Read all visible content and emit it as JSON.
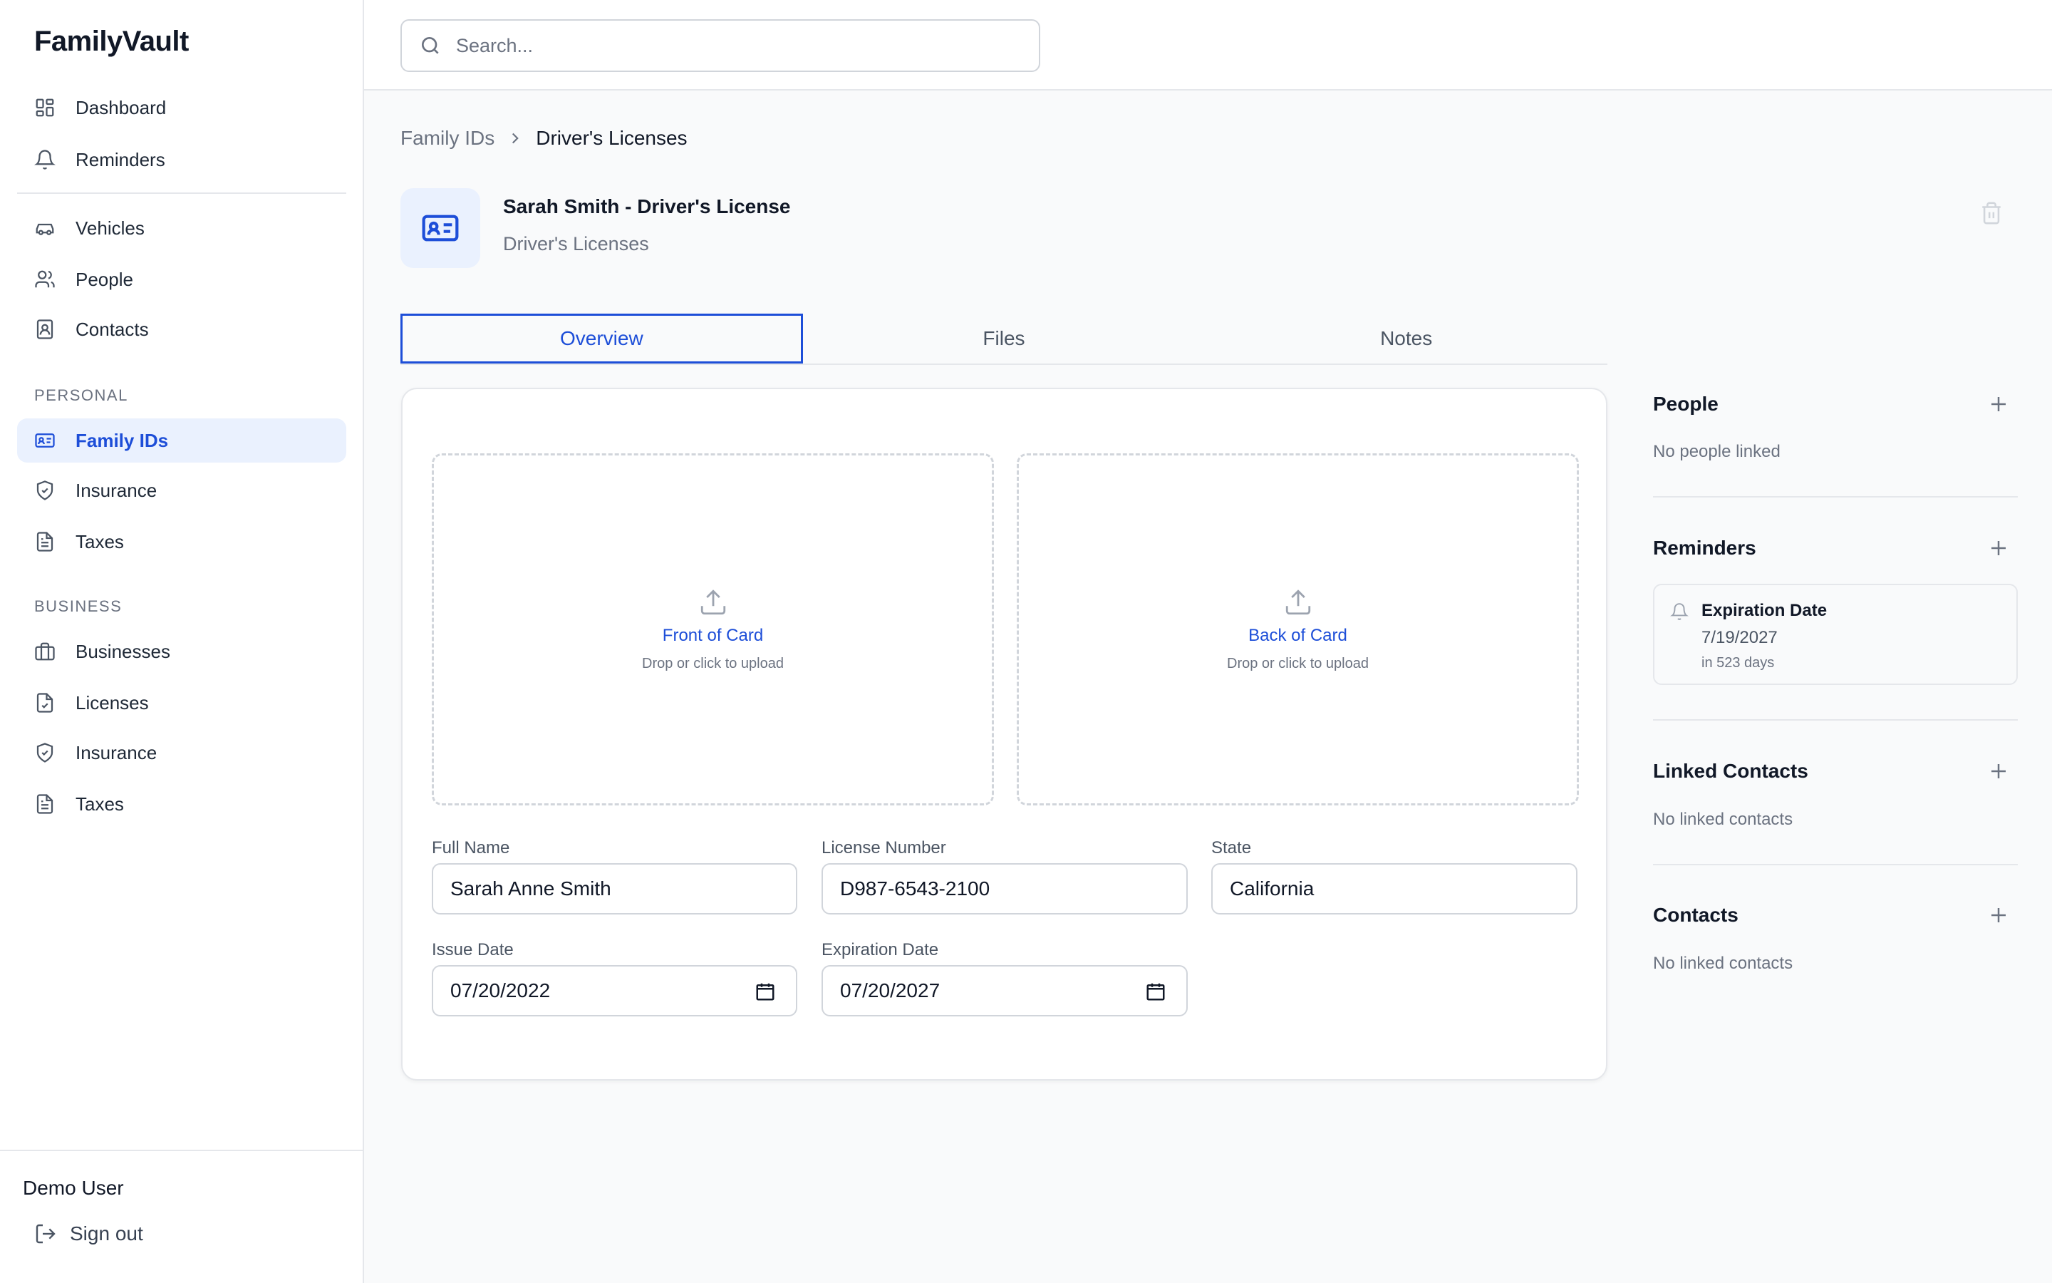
{
  "app": {
    "brand": "FamilyVault"
  },
  "sidebar": {
    "main_items": [
      {
        "label": "Dashboard",
        "icon": "dashboard-icon"
      },
      {
        "label": "Reminders",
        "icon": "bell-icon"
      },
      {
        "label": "Vehicles",
        "icon": "car-icon"
      },
      {
        "label": "People",
        "icon": "users-icon"
      },
      {
        "label": "Contacts",
        "icon": "contact-book-icon"
      }
    ],
    "personal": {
      "heading": "PERSONAL",
      "items": [
        {
          "label": "Family IDs",
          "icon": "id-card-icon",
          "active": true
        },
        {
          "label": "Insurance",
          "icon": "shield-icon"
        },
        {
          "label": "Taxes",
          "icon": "document-icon"
        }
      ]
    },
    "business": {
      "heading": "BUSINESS",
      "items": [
        {
          "label": "Businesses",
          "icon": "briefcase-icon"
        },
        {
          "label": "Licenses",
          "icon": "file-check-icon"
        },
        {
          "label": "Insurance",
          "icon": "shield-icon"
        },
        {
          "label": "Taxes",
          "icon": "document-icon"
        }
      ]
    },
    "footer": {
      "user_name": "Demo User",
      "signout_label": "Sign out"
    }
  },
  "search": {
    "placeholder": "Search...",
    "value": ""
  },
  "breadcrumb": {
    "parent": "Family IDs",
    "current": "Driver's Licenses"
  },
  "document": {
    "title": "Sarah Smith - Driver's License",
    "subtitle": "Driver's Licenses"
  },
  "tabs": [
    {
      "label": "Overview",
      "active": true
    },
    {
      "label": "Files",
      "active": false
    },
    {
      "label": "Notes",
      "active": false
    }
  ],
  "uploads": {
    "front": {
      "title": "Front of Card",
      "hint": "Drop or click to upload"
    },
    "back": {
      "title": "Back of Card",
      "hint": "Drop or click to upload"
    }
  },
  "fields": {
    "full_name": {
      "label": "Full Name",
      "value": "Sarah Anne Smith"
    },
    "license_number": {
      "label": "License Number",
      "value": "D987-6543-2100"
    },
    "state": {
      "label": "State",
      "value": "California"
    },
    "issue_date": {
      "label": "Issue Date",
      "value": "07/20/2022"
    },
    "expiration_date": {
      "label": "Expiration Date",
      "value": "07/20/2027"
    }
  },
  "right_panel": {
    "people": {
      "title": "People",
      "empty": "No people linked"
    },
    "reminders": {
      "title": "Reminders",
      "items": [
        {
          "title": "Expiration Date",
          "date": "7/19/2027",
          "relative": "in 523 days"
        }
      ]
    },
    "linked_contacts": {
      "title": "Linked Contacts",
      "empty": "No linked contacts"
    },
    "contacts": {
      "title": "Contacts",
      "empty": "No linked contacts"
    }
  },
  "colors": {
    "accent": "#1d4ed8",
    "active_bg": "#eaf1fe",
    "border": "#e5e7eb",
    "muted_text": "#6b7280"
  }
}
